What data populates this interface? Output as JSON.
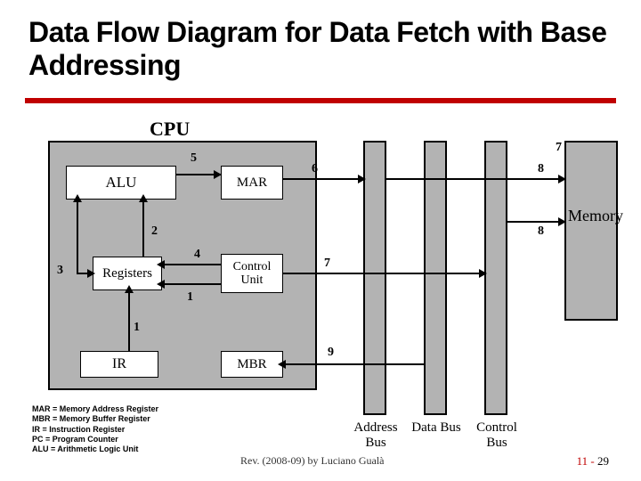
{
  "title": "Data Flow Diagram for Data Fetch with Base Addressing",
  "cpu_label": "CPU",
  "memory_label": "Memory",
  "boxes": {
    "alu": "ALU",
    "mar": "MAR",
    "regs": "Registers",
    "cu": "Control Unit",
    "ir": "IR",
    "mbr": "MBR"
  },
  "buses": {
    "address": "Address Bus",
    "data": "Data Bus",
    "control": "Control Bus"
  },
  "steps": {
    "s1a": "1",
    "s1b": "1",
    "s2": "2",
    "s3": "3",
    "s4": "4",
    "s5": "5",
    "s6": "6",
    "s7a": "7",
    "s7b": "7",
    "s8a": "8",
    "s8b": "8",
    "s9": "9"
  },
  "legend": {
    "l1": "MAR = Memory Address Register",
    "l2": "MBR = Memory Buffer Register",
    "l3": "IR = Instruction Register",
    "l4": "PC = Program Counter",
    "l5": "ALU = Arithmetic Logic Unit"
  },
  "footer": {
    "left": "Rev. (2008-09) by Luciano Gualà",
    "right_a": "11 -",
    "right_b": "29"
  }
}
